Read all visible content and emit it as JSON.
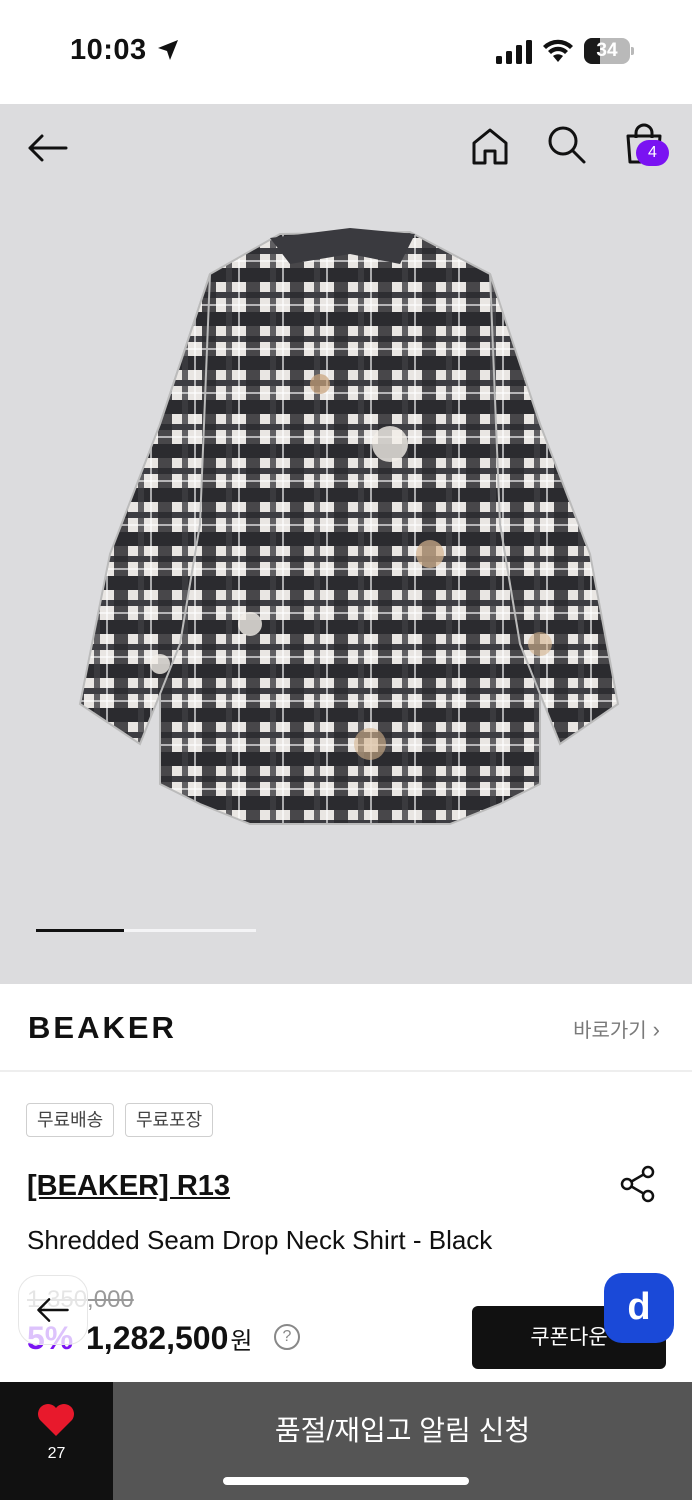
{
  "status_bar": {
    "time": "10:03",
    "battery_level": "34",
    "battery_fraction": 0.34
  },
  "header": {
    "cart_count": "4"
  },
  "gallery": {
    "progress_fraction": 0.4
  },
  "brand": {
    "logo": "BEAKER",
    "link_label": "바로가기"
  },
  "tags": [
    "무료배송",
    "무료포장"
  ],
  "product": {
    "brand_title": "[BEAKER] R13",
    "name": "Shredded Seam Drop Neck Shirt - Black",
    "original_price": "1,350,000",
    "discount": "5%",
    "price": "1,282,500",
    "price_unit": "원"
  },
  "actions": {
    "coupon_label": "쿠폰다운",
    "like_count": "27",
    "restock_label": "품절/재입고 알림 신청"
  },
  "colors": {
    "accent": "#7a13f2",
    "floating_button": "#1a49d8",
    "hero_bg": "#dcdcde"
  },
  "icons": [
    "location-arrow-icon",
    "signal-icon",
    "wifi-icon",
    "battery-icon",
    "back-arrow-icon",
    "home-icon",
    "search-icon",
    "cart-icon",
    "chevron-right-icon",
    "share-icon",
    "help-icon",
    "heart-icon"
  ]
}
